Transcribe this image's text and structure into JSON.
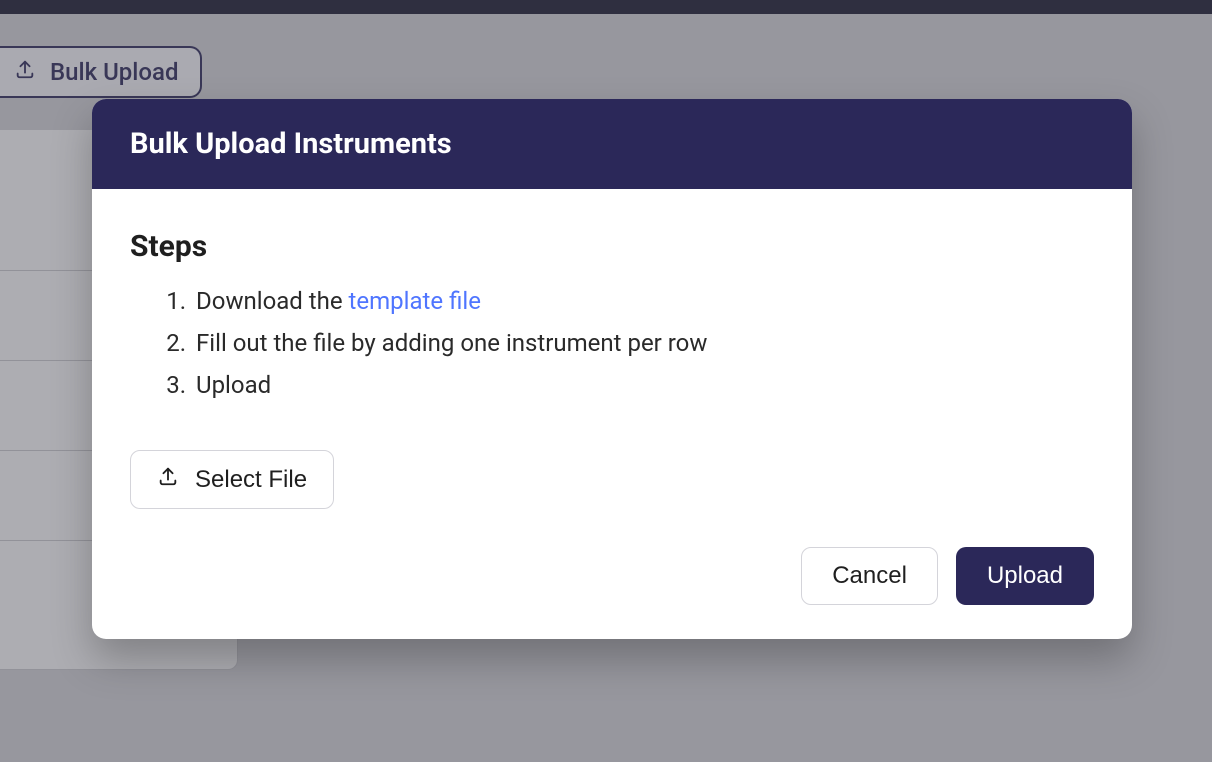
{
  "background": {
    "bulk_upload_label": "Bulk Upload"
  },
  "modal": {
    "title": "Bulk Upload Instruments",
    "steps_heading": "Steps",
    "steps": {
      "step1_prefix": "Download the ",
      "step1_link": "template file",
      "step2": "Fill out the file by adding one instrument per row",
      "step3": "Upload"
    },
    "select_file_label": "Select File",
    "cancel_label": "Cancel",
    "upload_label": "Upload"
  }
}
